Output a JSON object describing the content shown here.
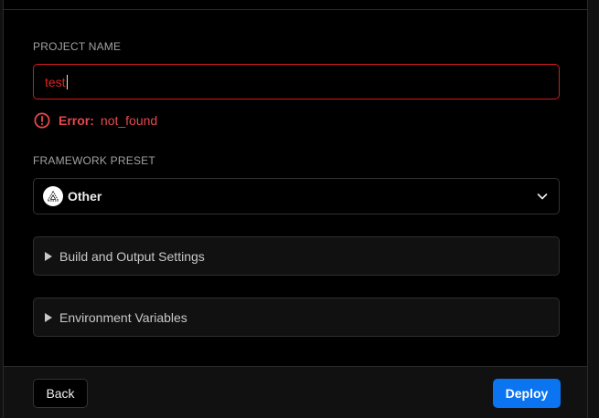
{
  "form": {
    "project_name_label": "PROJECT NAME",
    "project_name_value": "test",
    "error_prefix": "Error:",
    "error_message": "not_found",
    "framework_label": "FRAMEWORK PRESET",
    "framework_value": "Other",
    "framework_icon": "triangle-logo-icon"
  },
  "sections": [
    {
      "label": "Build and Output Settings",
      "expanded": false
    },
    {
      "label": "Environment Variables",
      "expanded": false
    }
  ],
  "footer": {
    "back_label": "Back",
    "deploy_label": "Deploy"
  },
  "colors": {
    "error": "#e5484d",
    "primary": "#0b74f1",
    "background": "#000000"
  }
}
